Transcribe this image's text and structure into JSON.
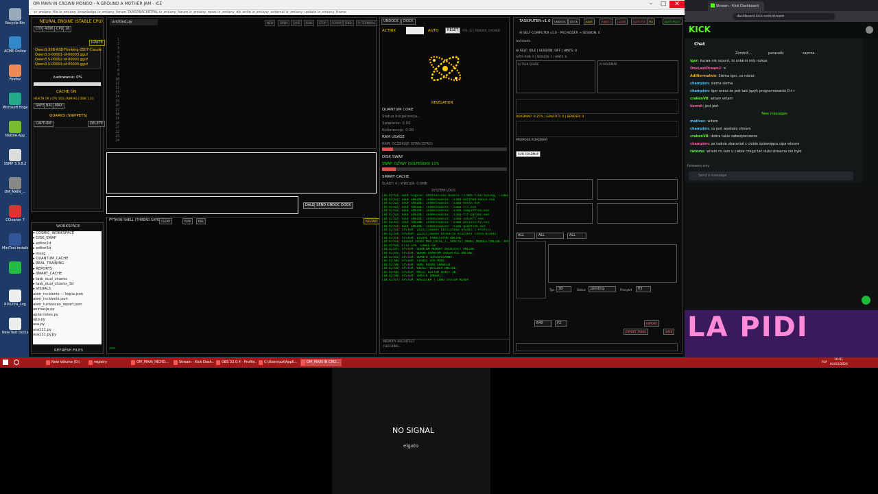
{
  "desktop": {
    "icons": [
      "Recycle Bin",
      "ACME Online",
      "Firefox",
      "Microsoft Edge",
      "NVIDIA App",
      "SSMP 3.0.8.2",
      "OM_MAIN_...",
      "CCleaner 7",
      "MiniTool Installer",
      "",
      "ROSTER_Log",
      "New Text Document"
    ]
  },
  "window": {
    "title": "OM MAIN IN CROWN MONGO - A GROUND A MOTHER JAM - ICE",
    "subtitle": "iz_zmiany_file   iz_zmiany_knowledge   iz_zmiany_forum   TAMSPBACERTFAL   iz_zmiany_forum   iz_zmiany_news   iz_zmiany_db_write   iz_zmiany_external   iz_zmiany_update   iz_zmiany_frame"
  },
  "engine": {
    "title": "NEURAL ENGINE (STABLE CPU)",
    "tabs": [
      "CTX",
      "4096",
      "CPU",
      "16"
    ],
    "ignite": "IGNITE",
    "models": [
      "Qwen3-30B-A3B-Thinking-2507-Claude",
      "Qwen3.5-00001-of-00003.gguf",
      "Qwen3.5-00002-of-00003.gguf",
      "Qwen3.5-00003-of-00003.gguf"
    ],
    "loading": "Ładowanie: 0%",
    "cache_on": "CACHE ON",
    "cache_stats": "HEALTH OK | CPU 16G | RAM 9G | DISK 1.1G",
    "cache_btns": [
      "SAFE",
      "BAL",
      "MAX"
    ],
    "quarks_title": "QUARKS (SNIPPETS)",
    "capture": "CAPTURE",
    "delete": "DELETE"
  },
  "workspace": {
    "title": "WORKSPACE",
    "tree": [
      "▾ COSMIC_WORKSPACE",
      "  ▸ DISK_SWAP",
      "  ▸ editor2d",
      "  ▸ editor3d",
      "  ▸ mozg",
      "  ▸ QUANTUM_CACHE",
      "  ▸ REAL_TRAINING",
      "  ▸ REPORTS",
      "  ▸ SMART_CACHE",
      "  ▸ task_dual_chunks",
      "  ▸ task_dual_chunks_3d",
      "  ▸ VISUALS",
      "    aiwir_incidents — kopia.json",
      "    aiwir_incidents.json",
      "    aiwir_turboscan_report.json",
      "    animacja.py",
      "    apka-notes.py",
      "    app.py",
      "    asa.py",
      "    asa111.py",
      "    asa111.py.py"
    ],
    "refresh": "REFRESH FILES"
  },
  "editor": {
    "tab": "untitled.py",
    "tools": [
      "NEW",
      "OPEN",
      "SAVE",
      "RUN",
      "STOP",
      "FORMAT",
      "FIND",
      "PI TERMINAL"
    ],
    "lines": [
      "1",
      "2",
      "3",
      "4",
      "5",
      "6",
      "7",
      "8",
      "9",
      "10",
      "11",
      "12",
      "13",
      "14",
      "15",
      "16",
      "17",
      "18",
      "19",
      "20",
      "21",
      "22",
      "23",
      "24"
    ]
  },
  "input": {
    "send_label": "DALEJ SEND UNDOC DOCK"
  },
  "shell": {
    "title": "PYTHON SHELL (THREAD SAFE)",
    "prompt": ">>>",
    "btns": [
      "CLEAR",
      "RUN",
      "KILL"
    ],
    "restart": "RESTART"
  },
  "center": {
    "tabs": [
      "UNDOCK",
      "DOCK"
    ],
    "actrix": "ACTRIX",
    "auto": "AUTO",
    "reset": "RESET",
    "fps": "FPS: 32 | RENDER: CACHED",
    "revelation": "REVELATION",
    "quantum_core": "QUANTUM CORE",
    "status": "Status Inicjalizacja...",
    "splatanie": "Splątanie: 0.00",
    "koherencja": "Koherencja: 0.00",
    "ram_usage": "RAM USAGE",
    "ram_status": "RAM: OCZEKUJE (STAN ZERO)",
    "disk_swap": "DISK SWAP",
    "swap_status": "SWAP: OŻYWY (SOLFEGGIO) 11%",
    "smart_cache": "SMART CACHE",
    "slady": "ŚLADY: 4 | WIEDZA: 0.0MB",
    "system_logs": "SYSTEM LOGS",
    "logs": [
      "[10:43:01] GGUF Engine: Odnaleziono modele (llama-fine-tuning, llama-cpp-13)...",
      "[10:43:02] GGUF ENGINE: Indeksowanie: llama-batched-bench.exe",
      "[10:43:02] GGUF ENGINE: Indeksowanie: llama-bench.exe",
      "[10:43:02] GGUF ENGINE: Indeksowanie: llama-cli.exe",
      "[10:43:02] GGUF ENGINE: Indeksowanie: llama-completion.exe",
      "[10:43:02] GGUF ENGINE: Indeksowanie: llama-fit-params.exe",
      "[10:43:02] GGUF ENGINE: Indeksowanie: llama-convert.exe",
      "[10:43:02] GGUF ENGINE: Indeksowanie: llama-perplexity.exe",
      "[10:43:02] GGUF ENGINE: Indeksowanie: llama-quantize.exe",
      "[10:43:03] SYSTEM: Zainicjowano bibliotekę Studio i Profili.",
      "[10:43:03] SYSTEM: Zainicjowano alokacje klasters (zero-blank).",
      "[10:43:03] SYSTEM: VISUAL FABRICATOR ONLINE.",
      "[10:43:03] Loaded index MAP_LOCAL_1__SRAC(6)_MODEL_MODULE:ONLINE: MAT 0 QAS",
      "[10:43:04] File LPS 'LABEL-CB'.",
      "[10:43:05] SYSTEM: QUANTUM MEMORY ARCHITECT ONLINE.",
      "[10:43:05] SYSTEM: QUARK QUANTUM INTERFACE ONLINE.",
      "[10:43:05] SYSTEM: OUANTA SUPERPOSANNA.",
      "[10:43:06] SYSTEM: STABLE CPU MODE.",
      "[10:43:06] SYSTEM: GRAL RADAR ENABLED.",
      "[10:43:06] SYSTEM: WIDGET BUILDER ONLINE.",
      "[10:43:06] SYSTEM: MAGIC EDITOR BUILT-IN.",
      "[10:43:06] SYSTEM: SPRITE INHERIT.",
      "[10:43:07] SYSTEM: KASIECKA | LOAD SYSTEM READY."
    ],
    "memory": "MEMORY ARCHITECT",
    "memory_status": "CHECKING..."
  },
  "taskputer": {
    "title": "TASKPUTER v1.0",
    "btns": [
      "UNDOCK",
      "DOCK",
      "SAVE",
      "REJECT",
      "CLOSE",
      "AUTO FIX",
      "FIX",
      "AUTO PILOT"
    ],
    "subtitle": "AI SELF-COMPUTER v1.0 - PRO KODER + SESSION: 0",
    "arch": "Architekt:",
    "ai_self": "AI SELF: IDLE | SESSION: OFF | HINTS: 0",
    "auto_run": "AUTO-RUN: 0 | SESSION: 1 | HINTS: 0",
    "a_task": "AI TASK QUEUE",
    "b_task": "AI ROADMAP",
    "bar1": "ROADMAP: 0 25% | GRAFFITI: 0 | BENDER: 0",
    "bar2": "PROPOSE ROADMAP:",
    "run_roadmap": "RUN ROADMAP",
    "filters": [
      "ALL",
      "ALL",
      "ALL"
    ],
    "fields": [
      "3D",
      "pending",
      "P3"
    ],
    "field_labels": [
      "Typ",
      "Status",
      "Priorytet"
    ],
    "bottom_fields": [
      "640",
      "P2"
    ],
    "bottom_btns": [
      "EXPORT",
      "EXPORT TASKS",
      "SAVE"
    ]
  },
  "browser": {
    "tab": "Stream - Kick Dashboard",
    "url": "dashboard.kick.com/stream",
    "logo": "KICK",
    "chat_title": "Chat",
    "chatters": [
      "ZombiX...",
      "parasolki",
      "sapcza..."
    ],
    "messages": [
      {
        "user": "Igor",
        "text": "kurwa nie szpont, to ostatni mój rozkaz"
      },
      {
        "user": "OneLastDream2",
        "text": "✕"
      },
      {
        "user": "AdiNormalnie",
        "text": "Siema Igor, co robisz"
      },
      {
        "user": "champion",
        "text": "siema siema"
      },
      {
        "user": "champion",
        "text": "Igor wiesz że jest taki język programowania D++"
      },
      {
        "user": "crakenVB",
        "text": "witam witam"
      },
      {
        "user": "kermit",
        "text": "jest jest"
      }
    ],
    "new_messages": "New messages",
    "messages2": [
      {
        "user": "matisoc",
        "text": "witam"
      },
      {
        "user": "champion",
        "text": "co jest wyebalo stream"
      },
      {
        "user": "crakenVB",
        "text": "dobra takie zabezpieczenie"
      },
      {
        "user": "champion",
        "text": "ze tadnie zbaraniał z ciebie śpiewająca cipa wlosne"
      },
      {
        "user": "twiomo",
        "text": "witam co tam u ciebie czego tak dużo streama nie było"
      }
    ],
    "followers_only": "Followers only",
    "send_placeholder": "Send a message",
    "banner": "LA PIDI"
  },
  "taskbar": {
    "items": [
      "New Volume (D:)",
      "registry",
      "OM_MAIN_INCRO...",
      "Stream - Kick Dash...",
      "OBS 32.0.4 - Profile...",
      "C:\\Users\\szi\\App0...",
      "OM_MAIN IN CRO..."
    ],
    "time": "16:01",
    "date": "04/03/2026",
    "lang": "PLP"
  },
  "capture": {
    "no_signal": "NO SIGNAL",
    "brand": "elgato"
  },
  "colors": {
    "accent": "#ffcc00",
    "log_green": "#00e000",
    "kick_green": "#53fc18",
    "taskbar_red": "#a01818"
  }
}
